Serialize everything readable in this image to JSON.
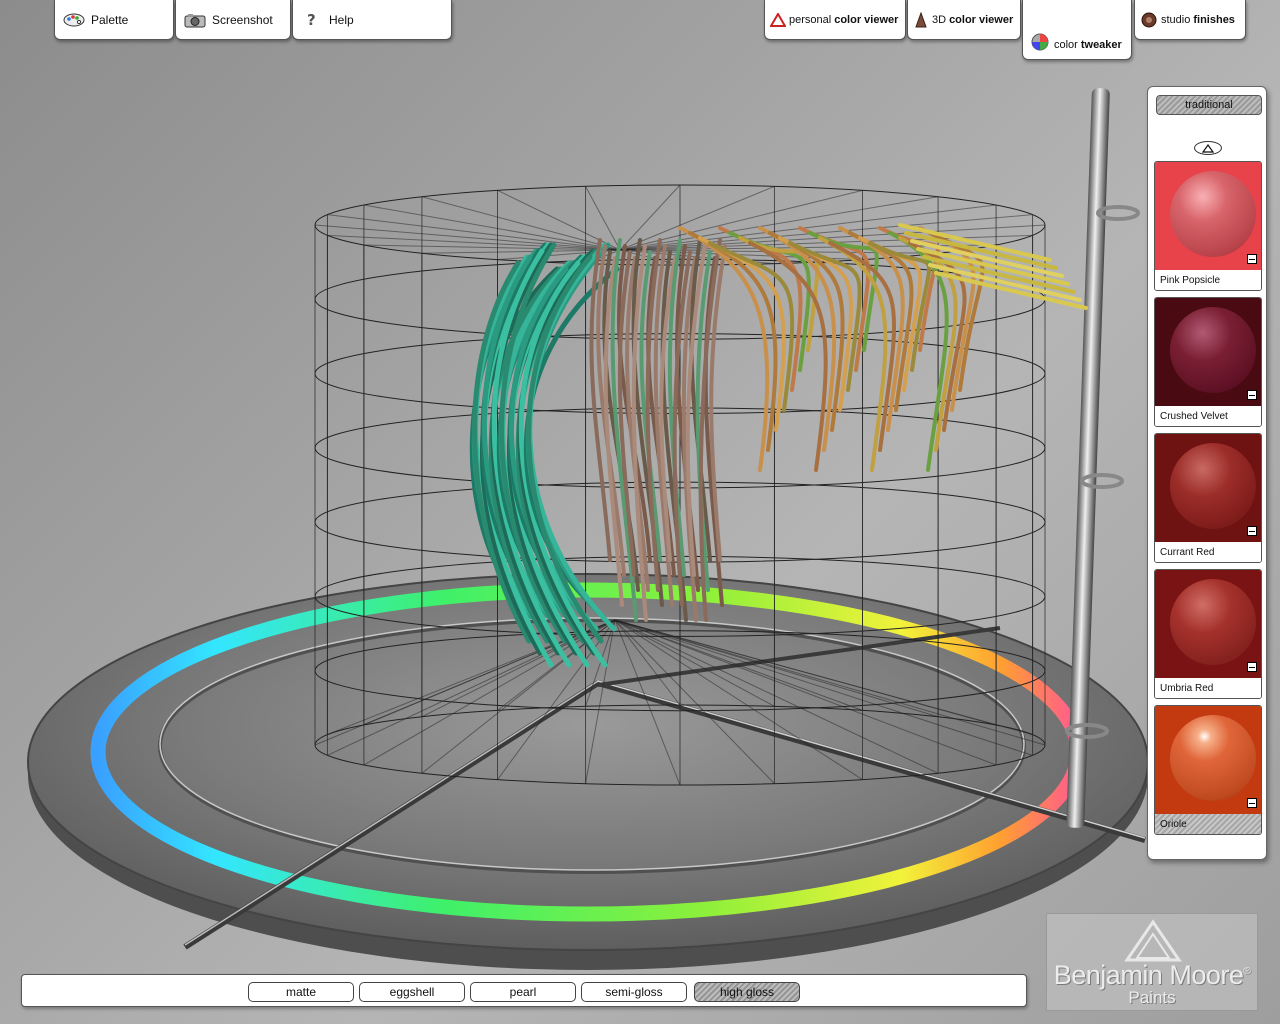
{
  "top_tabs_left": [
    {
      "label": "Palette",
      "icon": "palette-icon"
    },
    {
      "label": "Screenshot",
      "icon": "camera-icon"
    },
    {
      "label": "Help",
      "icon": "help-icon"
    }
  ],
  "top_tabs_right": [
    {
      "label_prefix": "personal",
      "label_bold": "color viewer",
      "icon": "warning-triangle-icon"
    },
    {
      "label_prefix": "3D",
      "label_bold": "color viewer",
      "icon": "paint-can-icon"
    },
    {
      "label_prefix": "color",
      "label_bold": "tweaker",
      "icon": "color-wheel-icon",
      "active": true
    },
    {
      "label_prefix": "studio",
      "label_bold": "finishes",
      "icon": "paint-roller-icon"
    }
  ],
  "panel": {
    "mode_label": "traditional",
    "swatches": [
      {
        "name": "Pink Popsicle",
        "color": "#e8424a",
        "ball": "#d8656b"
      },
      {
        "name": "Crushed Velvet",
        "color": "#4a0a12",
        "ball": "#7a1f33"
      },
      {
        "name": "Currant Red",
        "color": "#6e1212",
        "ball": "#9c2d29"
      },
      {
        "name": "Umbria Red",
        "color": "#7a1414",
        "ball": "#a5312c"
      },
      {
        "name": "Oriole",
        "color": "#c43a10",
        "ball": "#e0663a",
        "selected": true
      }
    ]
  },
  "finishes": [
    {
      "label": "matte"
    },
    {
      "label": "eggshell"
    },
    {
      "label": "pearl"
    },
    {
      "label": "semi-gloss"
    },
    {
      "label": "high gloss",
      "active": true
    }
  ],
  "logo": {
    "brand": "Benjamin Moore",
    "registered": "®",
    "sub": "Paints"
  }
}
